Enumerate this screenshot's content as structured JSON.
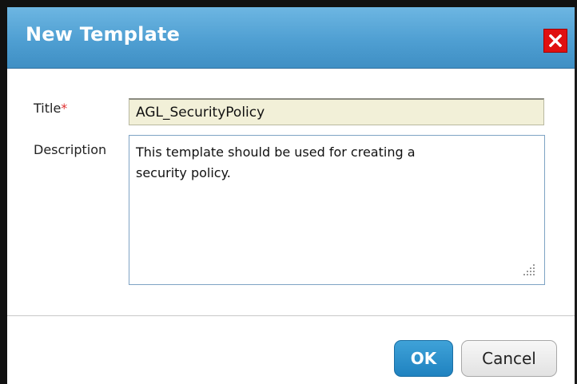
{
  "dialog": {
    "title": "New Template",
    "close_icon": "close-icon"
  },
  "form": {
    "title_label": "Title",
    "required_mark": "*",
    "title_value": "AGL_SecurityPolicy",
    "description_label": "Description",
    "description_value": "This template should be used for creating a\nsecurity policy."
  },
  "buttons": {
    "ok_label": "OK",
    "cancel_label": "Cancel"
  },
  "colors": {
    "titlebar": "#4f9fd2",
    "close_button": "#e01010",
    "title_input_bg": "#f2f0d8",
    "ok_button": "#1f82c0",
    "required_mark": "#e03030"
  }
}
